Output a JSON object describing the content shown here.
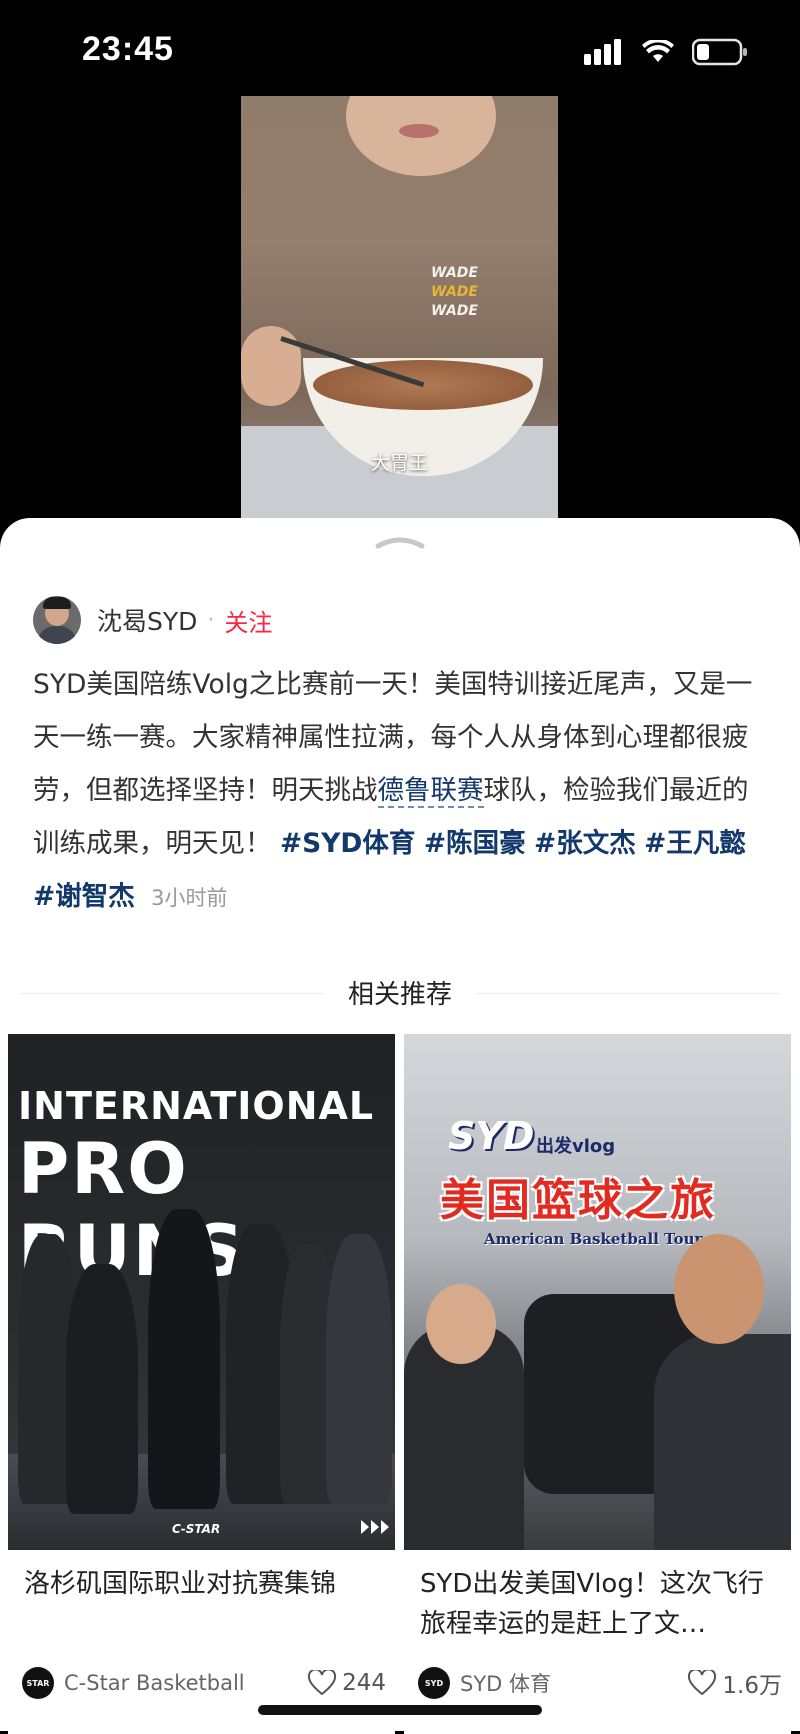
{
  "status": {
    "time": "23:45"
  },
  "video": {
    "caption": "大胃王",
    "shirt_text": [
      "WADE",
      "WADE",
      "WADE"
    ]
  },
  "post": {
    "author": "沈曷SYD",
    "follow_label": "关注",
    "text_part1": "SYD美国陪练Volg之比赛前一天！美国特训接近尾声，又是一天一练一赛。大家精神属性拉满，每个人从身体到心理都很疲劳，但都选择坚持！明天挑战",
    "link_text": "德鲁联赛",
    "text_part2": "球队，检验我们最近的训练成果，明天见！",
    "tags": [
      "#SYD体育",
      "#陈国豪",
      "#张文杰",
      "#王凡懿",
      "#谢智杰"
    ],
    "time": "3小时前"
  },
  "related": {
    "title": "相关推荐",
    "cards": [
      {
        "cover_line1": "INTERNATIONAL",
        "cover_line2": "PRO RUNS",
        "cover_brand": "C-STAR",
        "title": "洛杉矶国际职业对抗赛集锦",
        "author": "C-Star Basketball",
        "avatar_text": "STAR",
        "likes": "244"
      },
      {
        "cover_syd": "SYD",
        "cover_vlog": "出发vlog",
        "cover_main": "美国篮球之旅",
        "cover_sub": "American Basketball Tour",
        "title": "SYD出发美国Vlog！这次飞行旅程幸运的是赶上了文…",
        "author": "SYD 体育",
        "avatar_text": "SYD",
        "likes": "1.6万"
      }
    ]
  },
  "colors": {
    "accent": "#ff2442",
    "link": "#13386c"
  }
}
